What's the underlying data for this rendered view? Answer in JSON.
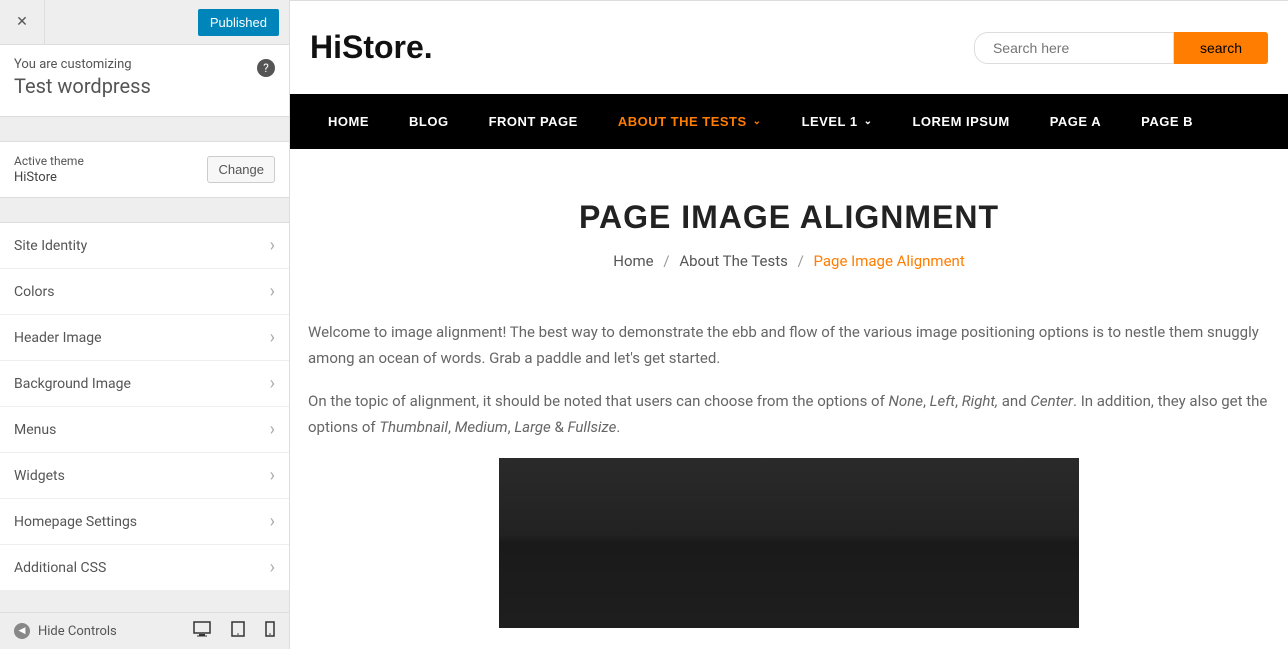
{
  "sidebar": {
    "publish_label": "Published",
    "customizing_label": "You are customizing",
    "site_title": "Test wordpress",
    "active_theme_label": "Active theme",
    "theme_name": "HiStore",
    "change_label": "Change",
    "accent_color": "#0085ba",
    "items": [
      {
        "label": "Site Identity"
      },
      {
        "label": "Colors"
      },
      {
        "label": "Header Image"
      },
      {
        "label": "Background Image"
      },
      {
        "label": "Menus"
      },
      {
        "label": "Widgets"
      },
      {
        "label": "Homepage Settings"
      },
      {
        "label": "Additional CSS"
      }
    ],
    "hide_controls_label": "Hide Controls"
  },
  "preview": {
    "brand": "HiStore",
    "brand_suffix": ".",
    "search_placeholder": "Search here",
    "search_button": "search",
    "accent_color": "#ff7d00",
    "nav": [
      {
        "label": "HOME",
        "active": false,
        "dropdown": false
      },
      {
        "label": "BLOG",
        "active": false,
        "dropdown": false
      },
      {
        "label": "FRONT PAGE",
        "active": false,
        "dropdown": false
      },
      {
        "label": "ABOUT THE TESTS",
        "active": true,
        "dropdown": true
      },
      {
        "label": "LEVEL 1",
        "active": false,
        "dropdown": true
      },
      {
        "label": "LOREM IPSUM",
        "active": false,
        "dropdown": false
      },
      {
        "label": "PAGE A",
        "active": false,
        "dropdown": false
      },
      {
        "label": "PAGE B",
        "active": false,
        "dropdown": false
      }
    ],
    "page_title": "PAGE IMAGE ALIGNMENT",
    "breadcrumb": {
      "home": "Home",
      "parent": "About The Tests",
      "current": "Page Image Alignment"
    },
    "content": {
      "p1": "Welcome to image alignment! The best way to demonstrate the ebb and flow of the various image positioning options is to nestle them snuggly among an ocean of words. Grab a paddle and let's get started.",
      "p2_a": "On the topic of alignment, it should be noted that users can choose from the options of ",
      "p2_none": "None",
      "p2_sep1": ", ",
      "p2_left": "Left",
      "p2_sep2": ", ",
      "p2_right": "Right,",
      "p2_and": " and ",
      "p2_center": "Center",
      "p2_b": ". In addition, they also get the options of ",
      "p2_thumb": "Thumbnail",
      "p2_sep3": ", ",
      "p2_medium": "Medium",
      "p2_sep4": ", ",
      "p2_large": "Large",
      "p2_amp": " & ",
      "p2_full": "Fullsize",
      "p2_end": "."
    }
  }
}
